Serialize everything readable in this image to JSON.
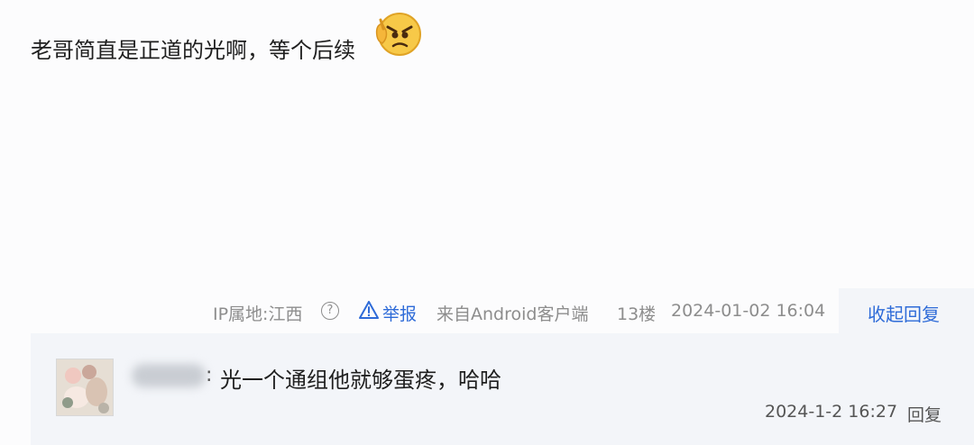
{
  "post": {
    "text": "老哥简直是正道的光啊，等个后续",
    "emoji_icon": "angry-thumbs-emoji-icon"
  },
  "meta": {
    "ip_location": "IP属地:江西",
    "help_icon_glyph": "?",
    "report_label": "举报",
    "source": "来自Android客户端",
    "floor": "13楼",
    "timestamp": "2024-01-02 16:04",
    "collapse_label": "收起回复"
  },
  "reply": {
    "colon": ":",
    "text": "光一个通组他就够蛋疼，哈哈",
    "timestamp": "2024-1-2 16:27",
    "reply_label": "回复"
  },
  "colors": {
    "link_blue": "#2e6bd8",
    "meta_gray": "#8d8d8d",
    "panel_bg": "#f3f5f9"
  }
}
